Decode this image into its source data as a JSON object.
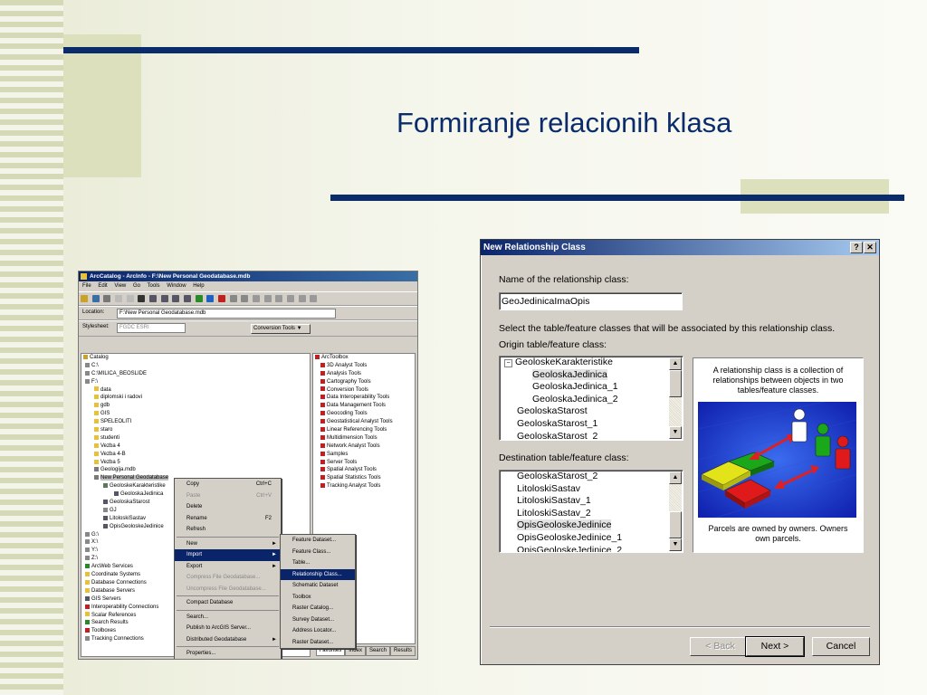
{
  "slide": {
    "title": "Formiranje relacionih klasa"
  },
  "arccatalog": {
    "window_title": "ArcCatalog - ArcInfo - F:\\New Personal Geodatabase.mdb",
    "menu": [
      "File",
      "Edit",
      "View",
      "Go",
      "Tools",
      "Window",
      "Help"
    ],
    "location_label": "Location:",
    "location_value": "F:\\New Personal Geodatabase.mdb",
    "stylesheet_label": "Stylesheet:",
    "stylesheet_value": "FGDC ESRI",
    "conversion_tools": "Conversion Tools ▼",
    "catalog_tree": [
      "Catalog",
      "C:\\",
      "C:\\MILICA_BEOSLIDE",
      "F:\\",
      "data",
      "diplomski i radovi",
      "gdb",
      "GIS",
      "SPELEOLITI",
      "staro",
      "studenti",
      "Vezba 4",
      "Vezba 4-B",
      "Vezba 5",
      "Geologija.mdb",
      "New Personal Geodatabase",
      "GeoloskeKarakteristike",
      "GeoloskaJedinica",
      "GeoloskaStarost",
      "GJ",
      "LitoloskiSastav",
      "OpisGeoloskeJedinice",
      "G:\\",
      "X:\\",
      "Y:\\",
      "Z:\\",
      "ArcWeb Services",
      "Coordinate Systems",
      "Database Connections",
      "Database Servers",
      "GIS Servers",
      "Interoperability Connections",
      "Scalar References",
      "Search Results",
      "Toolboxes",
      "Tracking Connections"
    ],
    "toolbox_tree": [
      "ArcToolbox",
      "3D Analyst Tools",
      "Analysis Tools",
      "Cartography Tools",
      "Conversion Tools",
      "Data Interoperability Tools",
      "Data Management Tools",
      "Geocoding Tools",
      "Geostatistical Analyst Tools",
      "Linear Referencing Tools",
      "Multidimension Tools",
      "Network Analyst Tools",
      "Samples",
      "Server Tools",
      "Spatial Analyst Tools",
      "Spatial Statistics Tools",
      "Tracking Analyst Tools"
    ],
    "context_menu": {
      "copy": "Copy",
      "copy_sc": "Ctrl+C",
      "paste": "Paste",
      "paste_sc": "Ctrl+V",
      "delete": "Delete",
      "rename": "Rename",
      "rename_sc": "F2",
      "refresh": "Refresh",
      "new": "New",
      "import": "Import",
      "export": "Export",
      "compress": "Compress File Geodatabase...",
      "uncompress": "Uncompress File Geodatabase...",
      "compact": "Compact Database",
      "search": "Search...",
      "publish": "Publish to ArcGIS Server...",
      "distributed": "Distributed Geodatabase",
      "properties": "Properties..."
    },
    "new_submenu": [
      "Feature Dataset...",
      "Feature Class...",
      "Table...",
      "Relationship Class...",
      "Schematic Dataset",
      "Toolbox",
      "Raster Catalog...",
      "Survey Dataset...",
      "Address Locator...",
      "Raster Dataset..."
    ],
    "tabs": [
      "Favorites",
      "Index",
      "Search",
      "Results"
    ]
  },
  "dialog": {
    "title": "New Relationship Class",
    "help_btn": "?",
    "close_btn": "✕",
    "name_label": "Name of the relationship class:",
    "name_value": "GeoJedinicaImaOpis",
    "select_text": "Select the table/feature classes that will be associated by this relationship class.",
    "origin_label": "Origin table/feature class:",
    "origin_items": [
      "GeoloskeKarakteristike",
      "GeoloskaJedinica",
      "GeoloskaJedinica_1",
      "GeoloskaJedinica_2",
      "GeoloskaStarost",
      "GeoloskaStarost_1",
      "GeoloskaStarost_2"
    ],
    "dest_label": "Destination table/feature class:",
    "dest_items": [
      "GeoloskaStarost_2",
      "LitoloskiSastav",
      "LitoloskiSastav_1",
      "LitoloskiSastav_2",
      "OpisGeoloskeJedinice",
      "OpisGeoloskeJedinice_1",
      "OpisGeoloskeJedinice_2"
    ],
    "info_top": "A relationship class is a collection of relationships between objects in two tables/feature classes.",
    "info_bottom": "Parcels are owned by owners. Owners own parcels.",
    "back_btn": "< Back",
    "next_btn": "Next >",
    "cancel_btn": "Cancel"
  },
  "colors": {
    "title": "#0b2c6b",
    "rule": "#0b2c6b",
    "accent_square": "#dde0bd"
  }
}
